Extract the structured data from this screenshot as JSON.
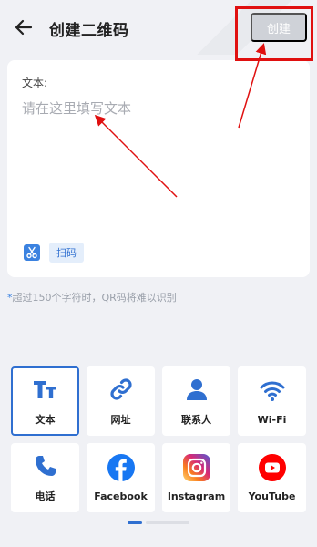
{
  "header": {
    "title": "创建二维码",
    "create_label": "创建"
  },
  "input": {
    "label": "文本:",
    "placeholder": "请在这里填写文本",
    "value": ""
  },
  "scan_label": "扫码",
  "hint": {
    "star": "*",
    "text": "超过150个字符时，QR码将难以识别"
  },
  "types": [
    {
      "label": "文本",
      "icon": "text-icon"
    },
    {
      "label": "网址",
      "icon": "link-icon"
    },
    {
      "label": "联系人",
      "icon": "contact-icon"
    },
    {
      "label": "Wi-Fi",
      "icon": "wifi-icon"
    },
    {
      "label": "电话",
      "icon": "phone-icon"
    },
    {
      "label": "Facebook",
      "icon": "facebook-icon"
    },
    {
      "label": "Instagram",
      "icon": "instagram-icon"
    },
    {
      "label": "YouTube",
      "icon": "youtube-icon"
    }
  ],
  "selected_type": "文本",
  "colors": {
    "accent": "#2f6fd0",
    "annotation": "#e01010",
    "facebook": "#1877f2",
    "youtube": "#ff0000"
  }
}
